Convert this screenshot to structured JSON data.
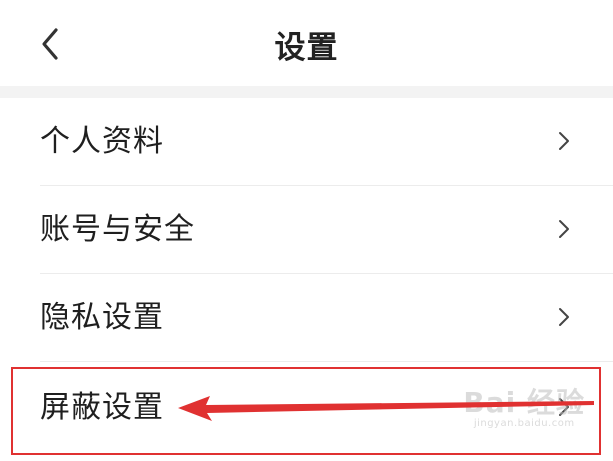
{
  "header": {
    "title": "设置",
    "back_icon": "chevron-left-icon"
  },
  "settings": {
    "items": [
      {
        "label": "个人资料",
        "icon": "chevron-right-icon"
      },
      {
        "label": "账号与安全",
        "icon": "chevron-right-icon"
      },
      {
        "label": "隐私设置",
        "icon": "chevron-right-icon"
      },
      {
        "label": "屏蔽设置",
        "icon": "chevron-right-icon"
      }
    ]
  },
  "annotation": {
    "highlight_color": "#e03131"
  },
  "watermark": {
    "main": "Bai 经验",
    "sub": "jingyan.baidu.com"
  }
}
